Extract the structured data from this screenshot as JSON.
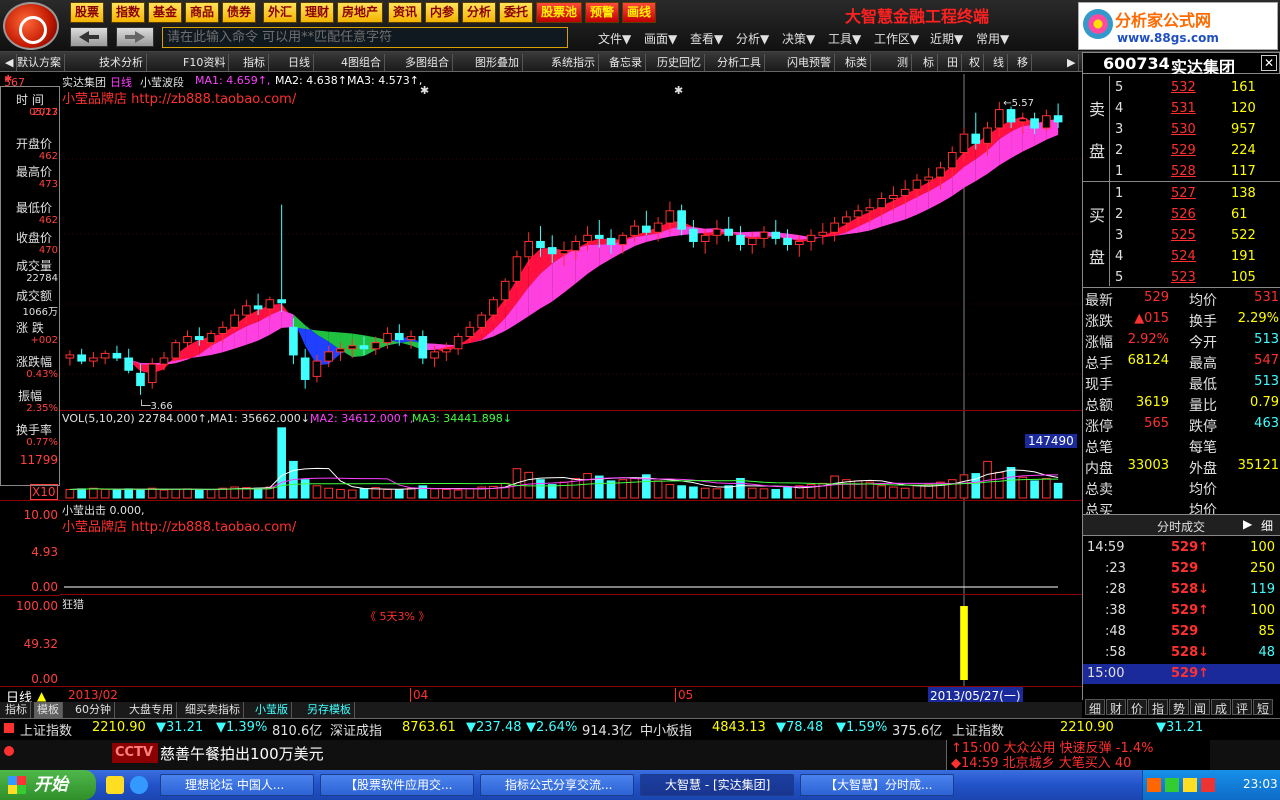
{
  "top_buttons": [
    "股票",
    "指数",
    "基金",
    "商品",
    "债券",
    "外汇",
    "理财",
    "房地产",
    "资讯",
    "内参",
    "分析",
    "委托",
    "股票池",
    "预警",
    "画线"
  ],
  "app_title": "大智慧金融工程终端",
  "brand": {
    "name": "分析家公式网",
    "url": "www.88gs.com"
  },
  "command_placeholder": "请在此输入命令   可以用**匹配任意字符",
  "menus": [
    "文件▼",
    "画面▼",
    "查看▼",
    "分析▼",
    "决策▼",
    "工具▼",
    "工作区▼",
    "近期▼",
    "常用▼"
  ],
  "toolbar": [
    "默认方案",
    "技术分析",
    "F10资料",
    "指标",
    "日线",
    "4图组合",
    "多图组合",
    "图形叠加",
    "系统指示",
    "备忘录",
    "历史回忆",
    "分析工具",
    "闪电预警",
    "标类",
    "测",
    "标",
    "田",
    "权",
    "线",
    "移"
  ],
  "stock": {
    "code": "600734",
    "name": "实达集团"
  },
  "chart_header": {
    "name": "实达集团",
    "period": "日线",
    "indicator": "小莹波段",
    "ma1_label": "MA1: 4.659↑,",
    "ma2_label": "MA2: 4.638↑,",
    "ma3_label": "MA3: 4.573↑,",
    "shop": "小莹品牌店 http://zb888.taobao.com/",
    "high_mark": "5.57",
    "low_mark": "3.66"
  },
  "vol_header": {
    "label": "VOL(5,10,20) 22784.000↑,",
    "ma1": "MA1: 35662.000↓,",
    "ma2": "MA2: 34612.000↑,",
    "ma3": "MA3: 34441.898↓",
    "current": "147490"
  },
  "vol_axis": {
    "top": "11799",
    "mult": "X10"
  },
  "p3_header": {
    "label": "小莹出击 0.000,",
    "shop": "小莹品牌店 http://zb888.taobao.com/"
  },
  "p3_axis": [
    "10.00",
    "4.93",
    "0.00"
  ],
  "p4_header": {
    "label": "狂猎",
    "note": "《 5天3% 》"
  },
  "p4_axis": [
    "100.00",
    "49.32",
    "0.00"
  ],
  "date_axis": {
    "period": "日线",
    "d1": "2013/02",
    "d2": "04",
    "d3": "05",
    "current": "2013/05/27(一)"
  },
  "left_info": [
    {
      "t": "时 间",
      "v": "2013"
    },
    {
      "t": "",
      "v": "05/27"
    },
    {
      "t": "开盘价",
      "v": "462"
    },
    {
      "t": "最高价",
      "v": "473"
    },
    {
      "t": "最低价",
      "v": "462"
    },
    {
      "t": "收盘价",
      "v": "470"
    },
    {
      "t": "成交量",
      "v": "22784"
    },
    {
      "t": "成交额",
      "v": "1066万"
    },
    {
      "t": "涨 跌",
      "v": "+002"
    },
    {
      "t": "涨跌幅",
      "v": "0.43%"
    },
    {
      "t": "振幅",
      "v": "2.35%"
    },
    {
      "t": "换手率",
      "v": "0.77%"
    }
  ],
  "left_top": "567",
  "sell": [
    {
      "n": "5",
      "p": "532",
      "v": "161"
    },
    {
      "n": "4",
      "p": "531",
      "v": "120"
    },
    {
      "n": "3",
      "p": "530",
      "v": "957"
    },
    {
      "n": "2",
      "p": "529",
      "v": "224"
    },
    {
      "n": "1",
      "p": "528",
      "v": "117"
    }
  ],
  "buy": [
    {
      "n": "1",
      "p": "527",
      "v": "138"
    },
    {
      "n": "2",
      "p": "526",
      "v": "61"
    },
    {
      "n": "3",
      "p": "525",
      "v": "522"
    },
    {
      "n": "4",
      "p": "524",
      "v": "191"
    },
    {
      "n": "5",
      "p": "523",
      "v": "105"
    }
  ],
  "sell_label": [
    "卖",
    "盘"
  ],
  "buy_label": [
    "买",
    "盘"
  ],
  "quote": [
    {
      "a": "最新",
      "av": "529",
      "b": "均价",
      "bv": "531"
    },
    {
      "a": "涨跌",
      "av": "▲015",
      "b": "换手",
      "bv": "2.29%"
    },
    {
      "a": "涨幅",
      "av": "2.92%",
      "b": "今开",
      "bv": "513"
    },
    {
      "a": "总手",
      "av": "68124",
      "b": "最高",
      "bv": "547"
    },
    {
      "a": "现手",
      "av": "",
      "b": "最低",
      "bv": "513"
    },
    {
      "a": "总额",
      "av": "3619",
      "b": "量比",
      "bv": "0.79"
    },
    {
      "a": "涨停",
      "av": "565",
      "b": "跌停",
      "bv": "463"
    },
    {
      "a": "总笔",
      "av": "",
      "b": "每笔",
      "bv": ""
    },
    {
      "a": "内盘",
      "av": "33003",
      "b": "外盘",
      "bv": "35121"
    },
    {
      "a": "总卖",
      "av": "",
      "b": "均价",
      "bv": ""
    },
    {
      "a": "总买",
      "av": "",
      "b": "均价",
      "bv": ""
    }
  ],
  "ticks_title": "分时成交",
  "ticks_detail": "细",
  "ticks": [
    {
      "t": "14:59",
      "p": "529↑",
      "v": "100"
    },
    {
      "t": ":23",
      "p": "529",
      "v": "250"
    },
    {
      "t": ":28",
      "p": "528↓",
      "v": "119"
    },
    {
      "t": ":38",
      "p": "529↑",
      "v": "100"
    },
    {
      "t": ":48",
      "p": "529",
      "v": "85"
    },
    {
      "t": ":58",
      "p": "528↓",
      "v": "48"
    },
    {
      "t": "15:00",
      "p": "529↑",
      "v": ""
    }
  ],
  "right_tabs": [
    "细",
    "财",
    "价",
    "指",
    "势",
    "闻",
    "成",
    "评",
    "短"
  ],
  "bottom_tabs": [
    "指标",
    "模板",
    "60分钟",
    "大盘专用",
    "细买卖指标",
    "小莹版",
    "另存模板"
  ],
  "ticker": [
    {
      "name": "上证指数",
      "val": "2210.90",
      "chg": "▼31.21",
      "pct": "▼1.39%",
      "amt": "810.6亿"
    },
    {
      "name": "深证成指",
      "val": "8763.61",
      "chg": "▼237.48",
      "pct": "▼2.64%",
      "amt": "914.3亿"
    },
    {
      "name": "中小板指",
      "val": "4843.13",
      "chg": "▼78.48",
      "pct": "▼1.59%",
      "amt": "375.6亿"
    }
  ],
  "ticker_right": {
    "name": "上证指数",
    "val": "2210.90",
    "chg": "▼31.21"
  },
  "news": "慈善午餐拍出100万美元",
  "news_right": [
    "↑15:00 大众公用 快速反弹 -1.4%",
    "◆14:59 北京城乡 大笔买入 40"
  ],
  "start": "开始",
  "tasks": [
    "理想论坛 中国人...",
    "【股票软件应用交...",
    "指标公式分享交流...",
    "大智慧 - [实达集团]",
    "【大智慧】分时成..."
  ],
  "clock": "23:03",
  "colors": {
    "up": "#ff3030",
    "down": "#40ffff",
    "yellow": "#ffff00",
    "magenta": "#ff40ff",
    "white": "#ffffff"
  },
  "chart_data": {
    "type": "candlestick",
    "ohlc": [
      [
        3.9,
        3.95,
        3.85,
        3.92
      ],
      [
        3.92,
        3.96,
        3.86,
        3.88
      ],
      [
        3.88,
        3.94,
        3.84,
        3.9
      ],
      [
        3.9,
        3.95,
        3.86,
        3.93
      ],
      [
        3.93,
        3.98,
        3.88,
        3.9
      ],
      [
        3.9,
        3.96,
        3.8,
        3.82
      ],
      [
        3.8,
        3.86,
        3.66,
        3.72
      ],
      [
        3.74,
        3.9,
        3.7,
        3.86
      ],
      [
        3.86,
        3.94,
        3.82,
        3.9
      ],
      [
        3.9,
        4.02,
        3.88,
        4.0
      ],
      [
        4.0,
        4.08,
        3.96,
        4.04
      ],
      [
        4.04,
        4.1,
        3.98,
        4.02
      ],
      [
        4.0,
        4.08,
        3.96,
        4.06
      ],
      [
        4.06,
        4.14,
        4.0,
        4.1
      ],
      [
        4.1,
        4.22,
        4.08,
        4.18
      ],
      [
        4.18,
        4.28,
        4.12,
        4.24
      ],
      [
        4.24,
        4.32,
        4.18,
        4.22
      ],
      [
        4.22,
        4.3,
        4.16,
        4.28
      ],
      [
        4.28,
        4.9,
        4.2,
        4.26
      ],
      [
        4.1,
        4.16,
        3.86,
        3.92
      ],
      [
        3.9,
        3.96,
        3.7,
        3.76
      ],
      [
        3.78,
        3.92,
        3.74,
        3.88
      ],
      [
        3.88,
        3.98,
        3.84,
        3.94
      ],
      [
        3.94,
        4.0,
        3.88,
        3.96
      ],
      [
        3.96,
        4.02,
        3.9,
        3.98
      ],
      [
        3.98,
        4.04,
        3.92,
        3.96
      ],
      [
        3.96,
        4.04,
        3.92,
        4.0
      ],
      [
        4.0,
        4.1,
        3.96,
        4.06
      ],
      [
        4.06,
        4.12,
        3.98,
        4.02
      ],
      [
        4.02,
        4.08,
        3.96,
        4.04
      ],
      [
        4.04,
        4.08,
        3.86,
        3.9
      ],
      [
        3.9,
        3.98,
        3.84,
        3.94
      ],
      [
        3.94,
        4.0,
        3.88,
        3.96
      ],
      [
        3.96,
        4.06,
        3.92,
        4.04
      ],
      [
        4.04,
        4.14,
        4.0,
        4.1
      ],
      [
        4.1,
        4.2,
        4.06,
        4.18
      ],
      [
        4.18,
        4.3,
        4.14,
        4.28
      ],
      [
        4.28,
        4.42,
        4.24,
        4.4
      ],
      [
        4.4,
        4.6,
        4.36,
        4.56
      ],
      [
        4.56,
        4.72,
        4.5,
        4.66
      ],
      [
        4.66,
        4.76,
        4.56,
        4.62
      ],
      [
        4.62,
        4.7,
        4.52,
        4.58
      ],
      [
        4.58,
        4.66,
        4.5,
        4.6
      ],
      [
        4.6,
        4.7,
        4.54,
        4.66
      ],
      [
        4.66,
        4.76,
        4.6,
        4.7
      ],
      [
        4.7,
        4.8,
        4.62,
        4.68
      ],
      [
        4.68,
        4.74,
        4.58,
        4.64
      ],
      [
        4.64,
        4.72,
        4.58,
        4.7
      ],
      [
        4.7,
        4.8,
        4.66,
        4.76
      ],
      [
        4.76,
        4.86,
        4.7,
        4.72
      ],
      [
        4.72,
        4.82,
        4.66,
        4.78
      ],
      [
        4.78,
        4.92,
        4.72,
        4.86
      ],
      [
        4.86,
        4.9,
        4.7,
        4.74
      ],
      [
        4.74,
        4.8,
        4.62,
        4.66
      ],
      [
        4.66,
        4.74,
        4.58,
        4.7
      ],
      [
        4.7,
        4.8,
        4.64,
        4.74
      ],
      [
        4.74,
        4.82,
        4.66,
        4.7
      ],
      [
        4.7,
        4.76,
        4.6,
        4.64
      ],
      [
        4.64,
        4.72,
        4.58,
        4.68
      ],
      [
        4.68,
        4.76,
        4.62,
        4.72
      ],
      [
        4.72,
        4.8,
        4.64,
        4.68
      ],
      [
        4.68,
        4.74,
        4.6,
        4.64
      ],
      [
        4.64,
        4.7,
        4.56,
        4.66
      ],
      [
        4.66,
        4.74,
        4.6,
        4.7
      ],
      [
        4.7,
        4.78,
        4.64,
        4.72
      ],
      [
        4.72,
        4.82,
        4.66,
        4.78
      ],
      [
        4.78,
        4.86,
        4.72,
        4.82
      ],
      [
        4.82,
        4.9,
        4.76,
        4.86
      ],
      [
        4.86,
        4.94,
        4.78,
        4.88
      ],
      [
        4.88,
        4.98,
        4.82,
        4.94
      ],
      [
        4.94,
        5.02,
        4.86,
        4.96
      ],
      [
        4.96,
        5.06,
        4.9,
        5.0
      ],
      [
        5.0,
        5.1,
        4.94,
        5.06
      ],
      [
        5.06,
        5.14,
        4.98,
        5.08
      ],
      [
        5.08,
        5.18,
        5.0,
        5.14
      ],
      [
        5.14,
        5.28,
        5.08,
        5.24
      ],
      [
        5.24,
        5.4,
        5.18,
        5.36
      ],
      [
        5.36,
        5.5,
        5.26,
        5.3
      ],
      [
        5.3,
        5.44,
        5.22,
        5.4
      ],
      [
        5.4,
        5.57,
        5.34,
        5.52
      ],
      [
        5.52,
        5.54,
        5.4,
        5.44
      ],
      [
        5.44,
        5.5,
        5.36,
        5.46
      ],
      [
        5.46,
        5.5,
        5.36,
        5.4
      ],
      [
        5.4,
        5.52,
        5.38,
        5.48
      ],
      [
        5.48,
        5.56,
        5.4,
        5.44
      ]
    ],
    "volume": [
      14,
      15,
      16,
      14,
      13,
      15,
      14,
      16,
      13,
      14,
      15,
      13,
      14,
      16,
      18,
      17,
      16,
      18,
      115,
      60,
      30,
      20,
      16,
      14,
      13,
      15,
      17,
      14,
      13,
      16,
      20,
      15,
      14,
      13,
      15,
      18,
      19,
      24,
      48,
      42,
      30,
      22,
      26,
      32,
      40,
      36,
      28,
      30,
      32,
      38,
      28,
      22,
      20,
      18,
      16,
      15,
      20,
      32,
      16,
      15,
      14,
      18,
      20,
      22,
      24,
      36,
      30,
      28,
      26,
      20,
      18,
      16,
      20,
      22,
      26,
      30,
      38,
      40,
      60,
      42,
      50,
      34,
      28,
      32,
      24
    ],
    "ylim": [
      3.6,
      5.7
    ],
    "vol_ylim": [
      0,
      118
    ],
    "p4_bar": {
      "index": 76,
      "value": 100
    }
  }
}
